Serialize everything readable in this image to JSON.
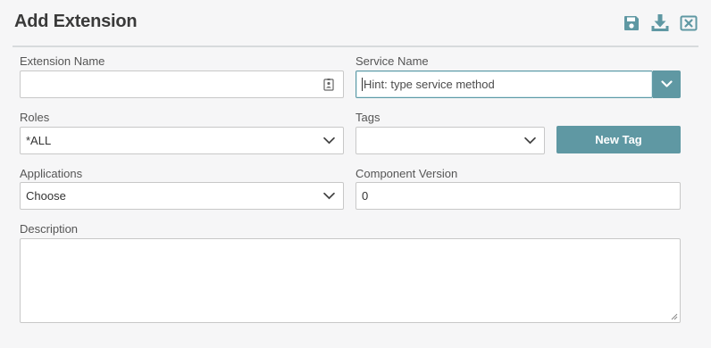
{
  "header": {
    "title": "Add Extension",
    "icons": [
      "save-icon",
      "download-icon",
      "close-icon"
    ]
  },
  "form": {
    "extension_name": {
      "label": "Extension Name",
      "value": ""
    },
    "service_name": {
      "label": "Service Name",
      "placeholder": "Hint: type service method"
    },
    "roles": {
      "label": "Roles",
      "value": "*ALL"
    },
    "tags": {
      "label": "Tags",
      "value": ""
    },
    "new_tag_label": "New Tag",
    "applications": {
      "label": "Applications",
      "value": "Choose"
    },
    "component_version": {
      "label": "Component Version",
      "value": "0"
    },
    "description": {
      "label": "Description",
      "value": ""
    }
  },
  "colors": {
    "accent": "#5f98a3",
    "background": "#f6f6f7",
    "border": "#c8c8c8"
  }
}
